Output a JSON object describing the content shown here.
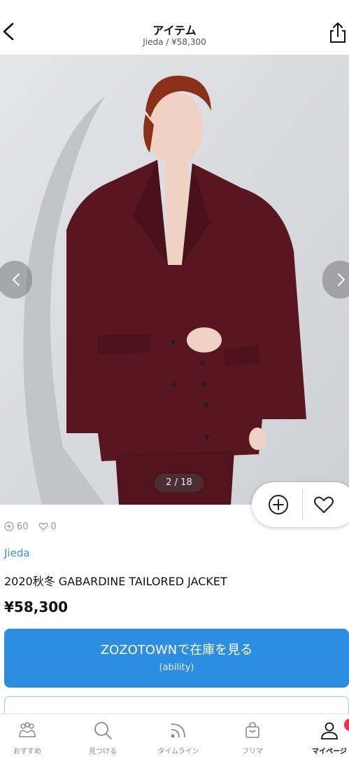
{
  "header": {
    "title": "アイテム",
    "subtitle": "Jieda / ¥58,300",
    "back_icon": "chevron-left-icon",
    "share_icon": "share-icon"
  },
  "gallery": {
    "page_indicator": "2 / 18",
    "current_page": 2,
    "total_pages": 18
  },
  "actions": {
    "add_icon": "plus-circle-icon",
    "like_icon": "heart-icon"
  },
  "stats": {
    "adds": "60",
    "likes": "0"
  },
  "item": {
    "brand": "Jieda",
    "name": "2020秋冬 GABARDINE TAILORED JACKET",
    "price": "¥58,300"
  },
  "cta": {
    "main_label": "ZOZOTOWNで在庫を見る",
    "sub_label": "(ability)",
    "color": "#2c8ee0"
  },
  "tabbar": {
    "items": [
      {
        "label": "おすすめ",
        "icon": "crowd-icon"
      },
      {
        "label": "見つける",
        "icon": "search-icon"
      },
      {
        "label": "タイムライン",
        "icon": "feed-icon"
      },
      {
        "label": "フリマ",
        "icon": "shopping-bag-icon"
      },
      {
        "label": "マイページ",
        "icon": "user-icon",
        "active": true
      }
    ]
  },
  "colors": {
    "accent": "#2c8ee0",
    "brand_link": "#3a8fd8",
    "notification": "#e8344a",
    "jacket": "#5a1620"
  }
}
